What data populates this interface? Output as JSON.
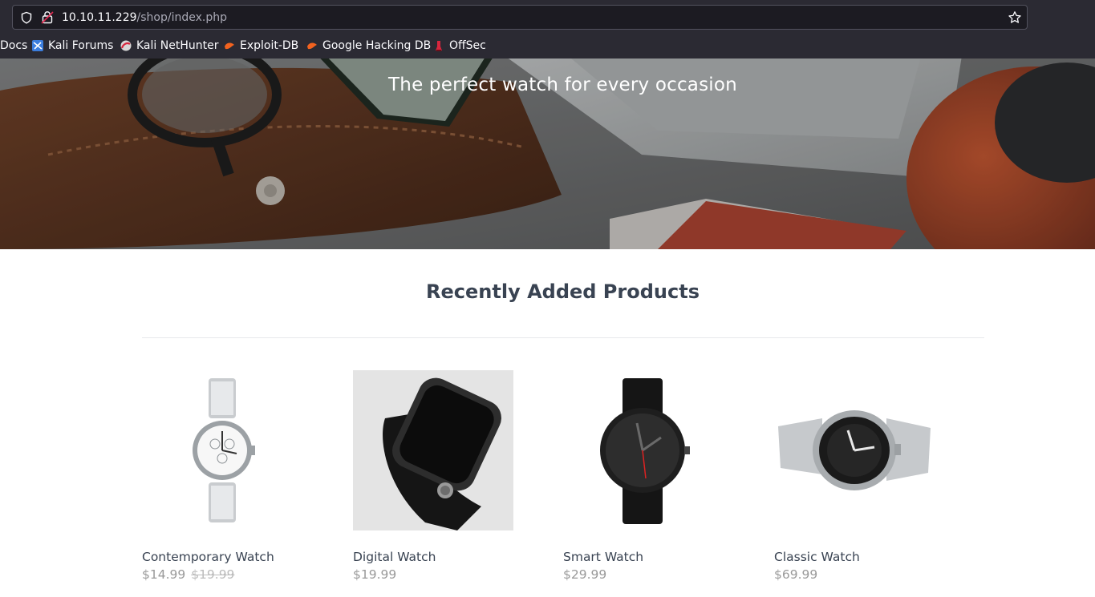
{
  "browser": {
    "url_host": "10.10.11.229",
    "url_path": "/shop/index.php",
    "bookmarks": [
      {
        "label": "Docs",
        "icon": "kali-docs-icon"
      },
      {
        "label": "Kali Forums",
        "icon": "kali-forums-icon"
      },
      {
        "label": "Kali NetHunter",
        "icon": "kali-nethunter-icon"
      },
      {
        "label": "Exploit-DB",
        "icon": "exploit-db-icon"
      },
      {
        "label": "Google Hacking DB",
        "icon": "google-hacking-db-icon"
      },
      {
        "label": "OffSec",
        "icon": "offsec-icon"
      }
    ]
  },
  "hero": {
    "tagline": "The perfect watch for every occasion"
  },
  "products_section": {
    "title": "Recently Added Products",
    "items": [
      {
        "name": "Contemporary Watch",
        "price": "$14.99",
        "rrp": "$19.99"
      },
      {
        "name": "Digital Watch",
        "price": "$19.99"
      },
      {
        "name": "Smart Watch",
        "price": "$29.99"
      },
      {
        "name": "Classic Watch",
        "price": "$69.99"
      }
    ]
  },
  "colors": {
    "chrome_bg": "#2b2a33",
    "urlbar_bg": "#1c1b22",
    "heading_text": "#394352",
    "price_text": "#999999"
  }
}
